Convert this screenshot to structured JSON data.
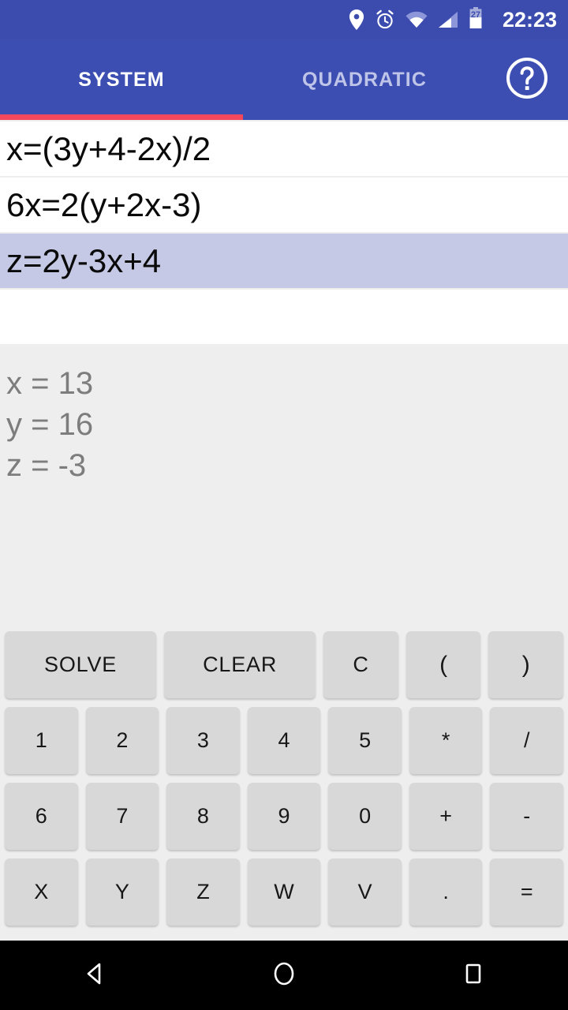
{
  "status_bar": {
    "time": "22:23",
    "battery_percent": "27",
    "icons": [
      "location-pin-icon",
      "alarm-icon",
      "wifi-icon",
      "signal-icon",
      "battery-icon"
    ],
    "background_color": "#3B4CAE"
  },
  "app_bar": {
    "background_color": "#3D4EB2",
    "indicator_color": "#F4485C",
    "tabs": [
      {
        "label": "SYSTEM",
        "active": true
      },
      {
        "label": "QUADRATIC",
        "active": false
      }
    ],
    "help_icon": "help-circle-icon"
  },
  "equations": {
    "selected_background": "#C6C9E6",
    "rows": [
      {
        "value": "x=(3y+4-2x)/2",
        "selected": false
      },
      {
        "value": "6x=2(y+2x-3)",
        "selected": false
      },
      {
        "value": "z=2y-3x+4",
        "selected": true
      },
      {
        "value": "",
        "selected": false
      }
    ],
    "placeholder": ""
  },
  "results": {
    "text_color": "#7D7D7D",
    "lines": [
      "x = 13",
      "y = 16",
      "z = -3"
    ]
  },
  "keypad": {
    "key_color": "#D7D8D7",
    "rows": [
      [
        {
          "label": "SOLVE",
          "wide": true
        },
        {
          "label": "CLEAR",
          "wide": true
        },
        {
          "label": "C",
          "wide": false
        },
        {
          "label": "(",
          "wide": false
        },
        {
          "label": ")",
          "wide": false
        }
      ],
      [
        {
          "label": "1",
          "wide": false
        },
        {
          "label": "2",
          "wide": false
        },
        {
          "label": "3",
          "wide": false
        },
        {
          "label": "4",
          "wide": false
        },
        {
          "label": "5",
          "wide": false
        },
        {
          "label": "*",
          "wide": false
        },
        {
          "label": "/",
          "wide": false
        }
      ],
      [
        {
          "label": "6",
          "wide": false
        },
        {
          "label": "7",
          "wide": false
        },
        {
          "label": "8",
          "wide": false
        },
        {
          "label": "9",
          "wide": false
        },
        {
          "label": "0",
          "wide": false
        },
        {
          "label": "+",
          "wide": false
        },
        {
          "label": "-",
          "wide": false
        }
      ],
      [
        {
          "label": "X",
          "wide": false
        },
        {
          "label": "Y",
          "wide": false
        },
        {
          "label": "Z",
          "wide": false
        },
        {
          "label": "W",
          "wide": false
        },
        {
          "label": "V",
          "wide": false
        },
        {
          "label": ".",
          "wide": false
        },
        {
          "label": "=",
          "wide": false
        }
      ]
    ]
  },
  "nav_bar": {
    "background_color": "#000000",
    "buttons": [
      "back-icon",
      "home-icon",
      "recents-icon"
    ]
  }
}
